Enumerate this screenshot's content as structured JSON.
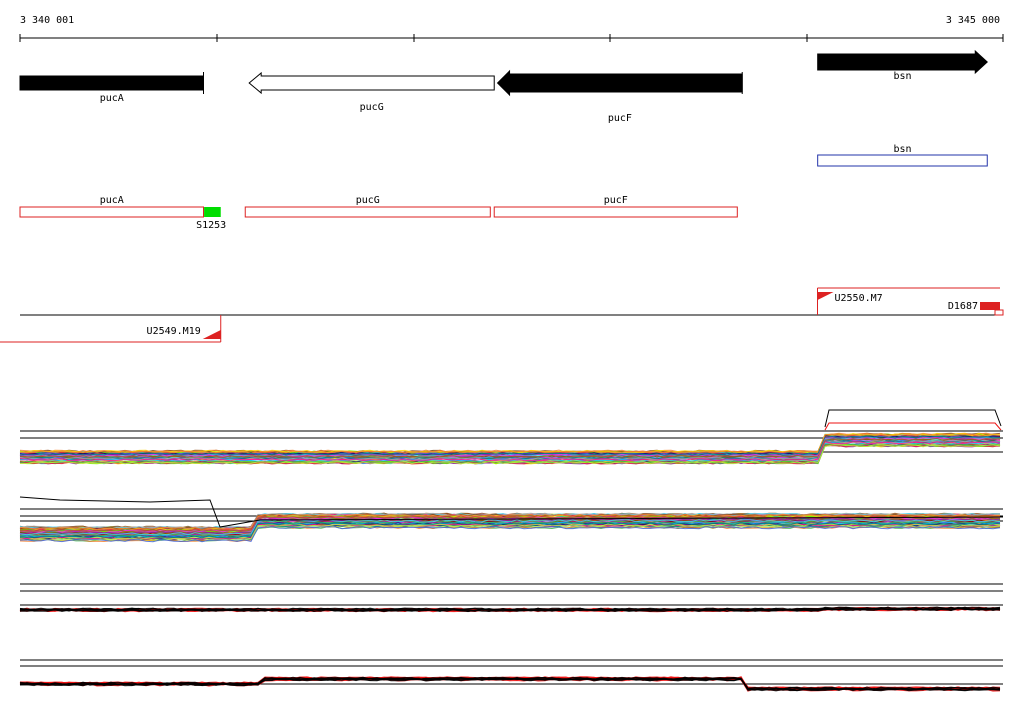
{
  "coordinates": {
    "start": "3 340 001",
    "end": "3 345 000"
  },
  "genes": [
    {
      "name": "pucA",
      "strand": "+",
      "style": "filled",
      "label_y": "below",
      "start": 3340001,
      "end": 3340937
    },
    {
      "name": "pucG",
      "strand": "-",
      "style": "outline",
      "start": 3341170,
      "end": 3342420
    },
    {
      "name": "pucF",
      "strand": "-",
      "style": "filled",
      "start": 3342437,
      "end": 3343685
    },
    {
      "name": "bsn",
      "strand": "+",
      "style": "filled",
      "start": 3344070,
      "end": 3344935
    }
  ],
  "annotation_boxes": [
    {
      "name": "bsn",
      "color": "#2233aa",
      "start": 3344070,
      "end": 3344935
    }
  ],
  "orf_boxes": [
    {
      "name": "pucA",
      "start": 3340001,
      "end": 3340937
    },
    {
      "name": "pucG",
      "start": 3341150,
      "end": 3342400
    },
    {
      "name": "pucF",
      "start": 3342420,
      "end": 3343660
    }
  ],
  "sites": [
    {
      "name": "S1253",
      "color": "#00dd00",
      "start": 3340940,
      "end": 3341025
    }
  ],
  "upstream_regions": [
    {
      "name": "U2550.M7",
      "direction": "+",
      "start": 3344069,
      "end": 3345000
    },
    {
      "name": "U2549.M19",
      "direction": "-",
      "start": 3339900,
      "end": 3341025
    }
  ],
  "downstream_regions": [
    {
      "name": "D1687",
      "start": 3344900,
      "end": 3345000
    }
  ],
  "colors": {
    "gene": "#000000",
    "orf_box": "#dd2222",
    "region_line": "#dd2222",
    "profile_palette": [
      "#e6194b",
      "#3cb44b",
      "#4363d8",
      "#f58231",
      "#911eb4",
      "#42d4f4",
      "#f032e6",
      "#bfef45",
      "#008080",
      "#9a6324",
      "#800000",
      "#aaffc3",
      "#808000",
      "#000075",
      "#a9a9a9",
      "#ffd700",
      "#00bfff",
      "#ff1493",
      "#7cfc00",
      "#8b4513"
    ]
  }
}
